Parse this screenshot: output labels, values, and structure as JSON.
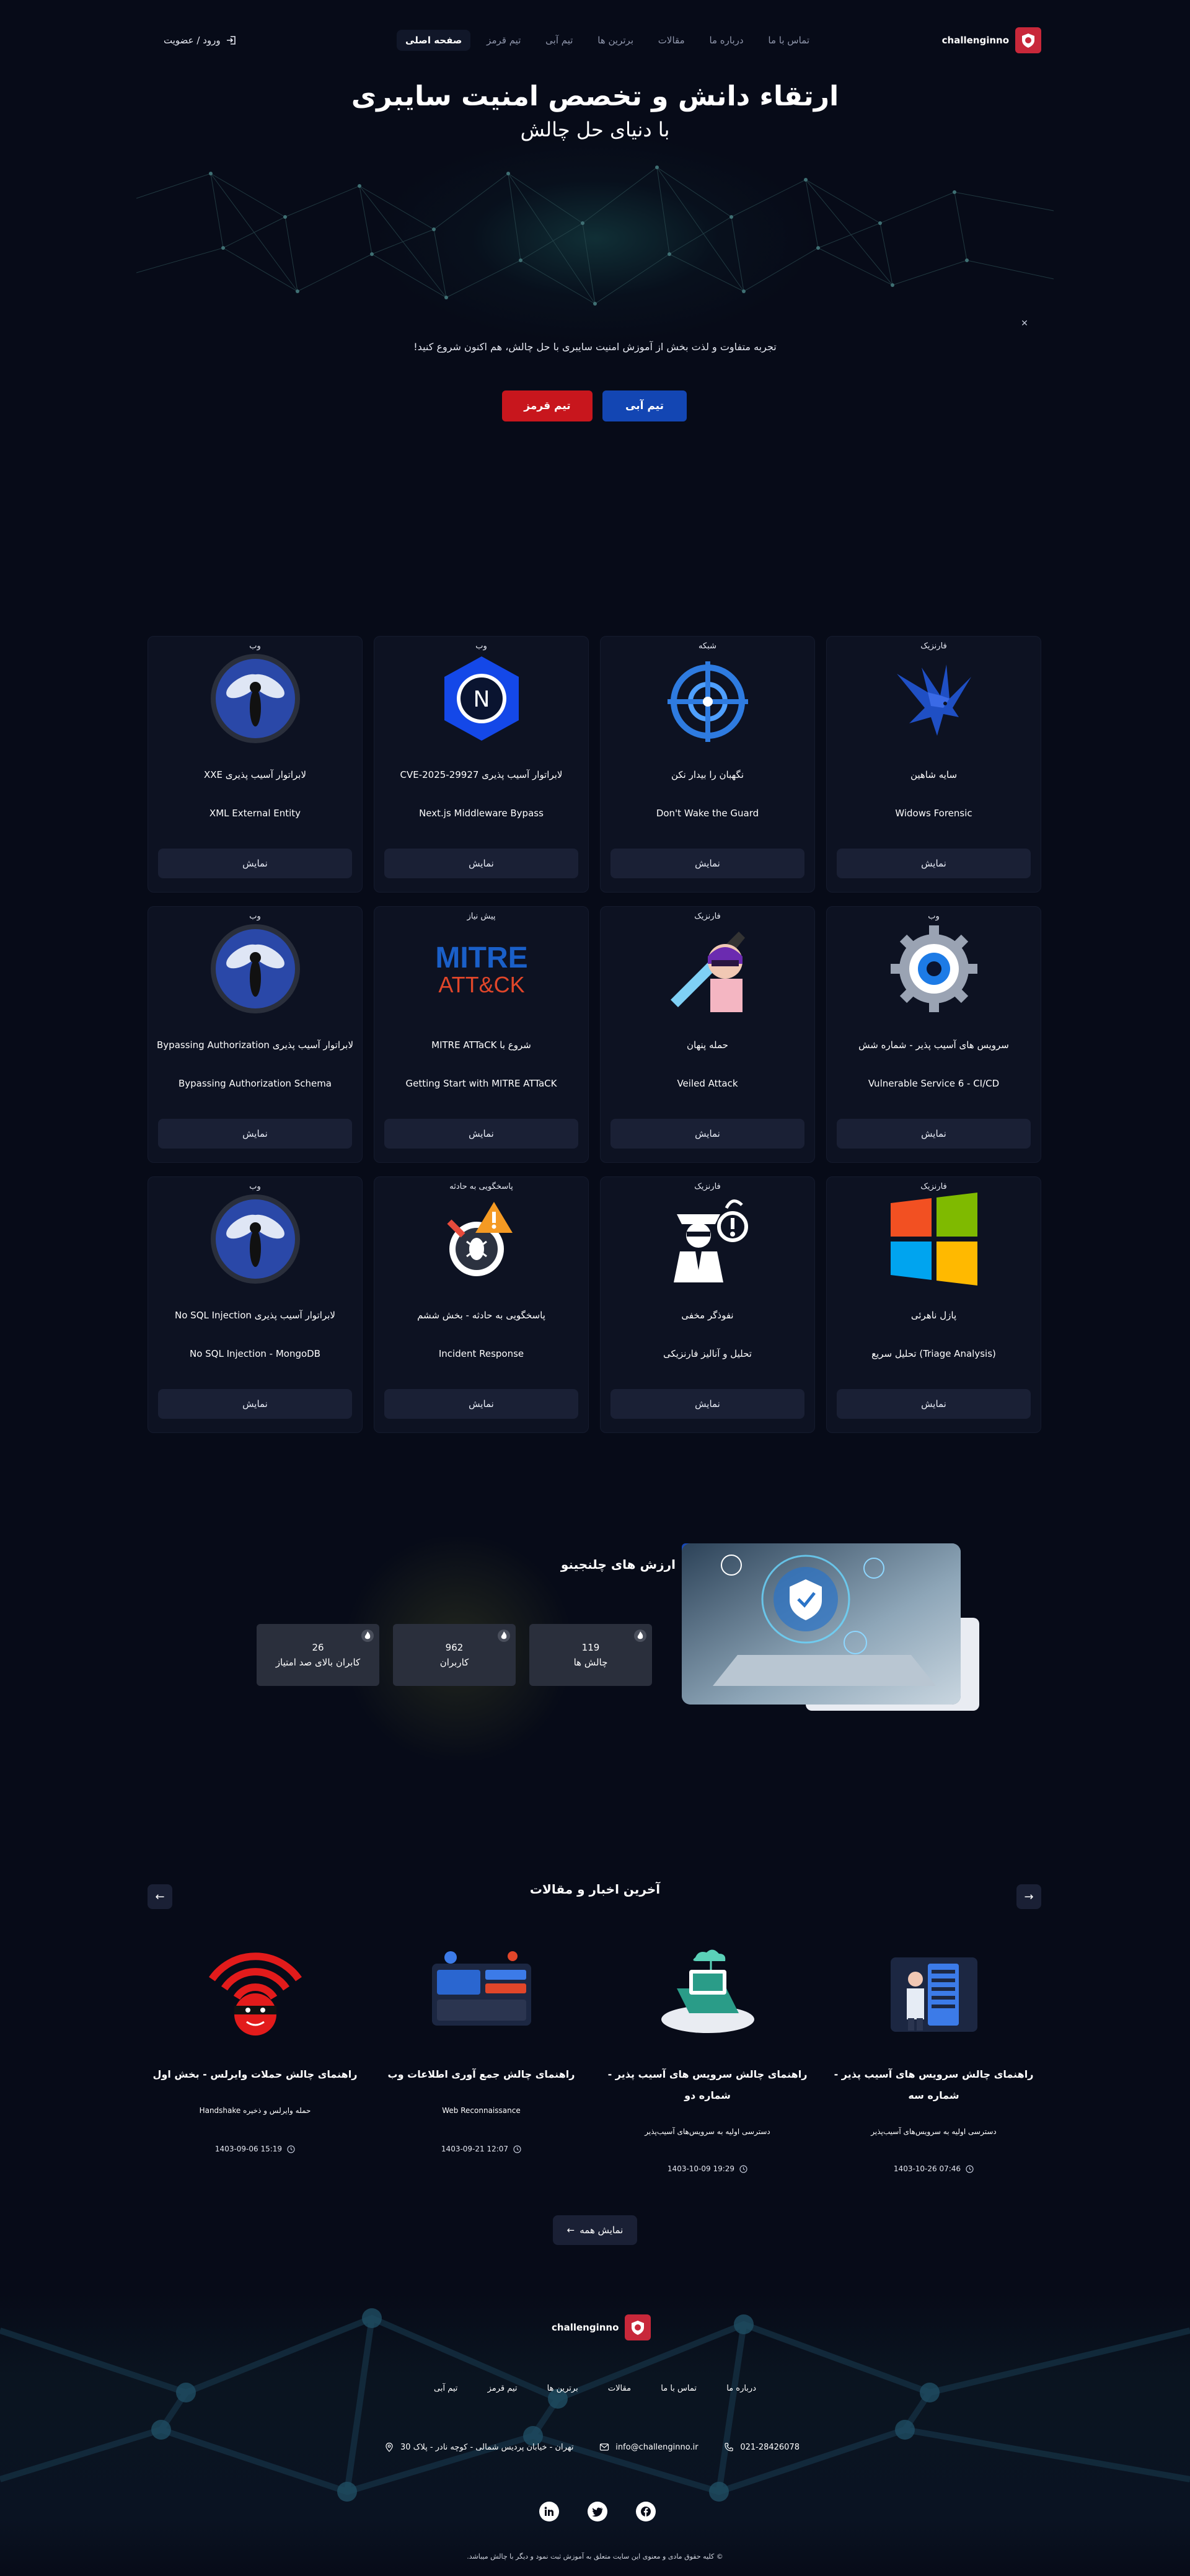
{
  "header": {
    "logo_text": "challenginno",
    "nav": [
      "صفحه اصلی",
      "تیم قرمز",
      "تیم آبی",
      "برترین ها",
      "مقالات",
      "درباره ما",
      "تماس با ما"
    ],
    "login": "ورود / عضویت"
  },
  "hero": {
    "title": "ارتقاء دانش و تخصص امنیت سایبری",
    "subtitle": "با دنیای حل چالش",
    "description": "تجربه متفاوت و لذت بخش از آموزش امنیت سایبری با حل چالش، هم اکنون شروع کنید!",
    "close": "✕",
    "btn_blue": "تیم آبی",
    "btn_red": "تیم قرمز"
  },
  "challenges": [
    {
      "category": "فارنزیک",
      "title_fa": "سایه شاهین",
      "title_en": "Widows Forensic",
      "icon": "eagle-icon",
      "button": "نمایش"
    },
    {
      "category": "شبکه",
      "title_fa": "نگهبان را بیدار نکن",
      "title_en": "Don't Wake the Guard",
      "icon": "target-icon",
      "button": "نمایش"
    },
    {
      "category": "وب",
      "title_fa": "لابراتوار آسیب پذیری CVE-2025-29927",
      "title_en": "Next.js Middleware Bypass",
      "icon": "nextjs-icon",
      "button": "نمایش"
    },
    {
      "category": "وب",
      "title_fa": "لابراتوار آسیب پذیری XXE",
      "title_en": "XML External Entity",
      "icon": "owasp-wasp-icon",
      "button": "نمایش"
    },
    {
      "category": "وب",
      "title_fa": "سرویس های آسیب پذیر - شماره شش",
      "title_en": "Vulnerable Service 6 - CI/CD",
      "icon": "gear-eye-icon",
      "button": "نمایش"
    },
    {
      "category": "فارنزیک",
      "title_fa": "حمله پنهان",
      "title_en": "Veiled Attack",
      "icon": "ninja-sword-icon",
      "button": "نمایش"
    },
    {
      "category": "پیش نیاز",
      "title_fa": "شروع با MITRE ATTaCK",
      "title_en": "Getting Start with MITRE ATTaCK",
      "icon": "mitre-attack-logo",
      "button": "نمایش"
    },
    {
      "category": "وب",
      "title_fa": "لابراتوار آسیب پذیری Bypassing Authorization",
      "title_en": "Bypassing Authorization Schema",
      "icon": "owasp-wasp-icon",
      "button": "نمایش"
    },
    {
      "category": "فارنزیک",
      "title_fa": "پازل ناهرئی",
      "title_en": "(Triage Analysis) تحلیل سریع",
      "icon": "windows-logo-icon",
      "button": "نمایش"
    },
    {
      "category": "فارنزیک",
      "title_fa": "نفوذگر مخفی",
      "title_en": "تحلیل و آنالیز فارنزیکی",
      "icon": "spy-agent-icon",
      "button": "نمایش"
    },
    {
      "category": "پاسخگویی به حادثه",
      "title_fa": "پاسخگویی به حادثه - بخش ششم",
      "title_en": "Incident Response",
      "icon": "bug-magnifier-icon",
      "button": "نمایش"
    },
    {
      "category": "وب",
      "title_fa": "لابراتوار آسیب پذیری No SQL Injection",
      "title_en": "No SQL Injection - MongoDB",
      "icon": "owasp-wasp-icon",
      "button": "نمایش"
    }
  ],
  "values": {
    "title": "ارزش های چلنجینو",
    "stats": [
      {
        "number": "26",
        "label": "کابران بالای صد امتیاز"
      },
      {
        "number": "962",
        "label": "کاربران"
      },
      {
        "number": "119",
        "label": "چالش ها"
      }
    ]
  },
  "news": {
    "title": "آخرین اخبار و مقالات",
    "items": [
      {
        "title": "راهنمای چالش سرویس های آسیب پذیر - شماره سه",
        "excerpt": "دسترسی اولیه به سرویس‌های آسیب‌پذیر",
        "date": "1403-10-26 07:46",
        "image": "server-person-illustration"
      },
      {
        "title": "راهنمای چالش سرویس های آسیب پذیر - شماره دو",
        "excerpt": "دسترسی اولیه به سرویس‌های آسیب‌پذیر",
        "date": "1403-10-09 19:29",
        "image": "cloud-laptop-illustration"
      },
      {
        "title": "راهنمای چالش جمع آوری اطلاعات وب",
        "excerpt": "Web Reconnaissance",
        "date": "1403-09-21 12:07",
        "image": "web-dashboard-illustration"
      },
      {
        "title": "راهنمای چالش حملات وایرلس - بخش اول",
        "excerpt": "حمله وایرلس و ذخیره Handshake",
        "date": "1403-09-06 15:19",
        "image": "wifi-ninja-illustration"
      }
    ],
    "show_all": "نمایش همه"
  },
  "footer": {
    "logo_text": "challenginno",
    "links": [
      "تیم آبی",
      "تیم قرمز",
      "برترین ها",
      "مقالات",
      "تماس با ما",
      "درباره ما"
    ],
    "phone": "021-28426078",
    "email": "info@challenginno.ir",
    "address": "تهران - خیابان پردیس شمالی - کوچه نادر - پلاک 30",
    "copyright": "© کلیه حقوق مادی و معنوی این سایت متعلق به آموزش ثبت نمود و دیگر با چالش میباشد."
  },
  "colors": {
    "background": "#070b18",
    "card": "#0d1222",
    "red": "#c8161d",
    "blue": "#1346b3",
    "brand": "#c8283a"
  }
}
